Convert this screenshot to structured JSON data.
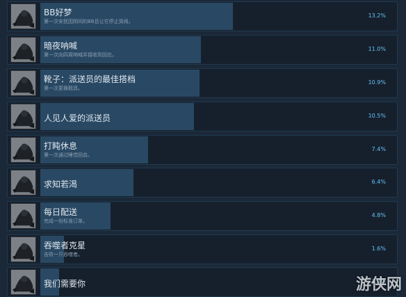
{
  "achievements": [
    {
      "title": "BB好梦",
      "desc": "第一次安抚因阴间的BB且让它停止哭闹。",
      "percent": "13.2%",
      "fill": 0.132,
      "icon": "bb-pod-icon"
    },
    {
      "title": "暗夜呐喊",
      "desc": "第一次向四周呐喊并接收到回应。",
      "percent": "11.0%",
      "fill": 0.11,
      "icon": "shout-icon"
    },
    {
      "title": "靴子：派送员的最佳搭档",
      "desc": "第一次更换鞋具。",
      "percent": "10.9%",
      "fill": 0.109,
      "icon": "boots-icon"
    },
    {
      "title": "人见人爱的派送员",
      "desc": "",
      "percent": "10.5%",
      "fill": 0.105,
      "icon": "porter-icon"
    },
    {
      "title": "打盹休息",
      "desc": "第一次通过睡觉回血。",
      "percent": "7.4%",
      "fill": 0.074,
      "icon": "rest-icon"
    },
    {
      "title": "求知若渴",
      "desc": "",
      "percent": "6.4%",
      "fill": 0.064,
      "icon": "canteen-icon"
    },
    {
      "title": "每日配送",
      "desc": "完成一份标准订单。",
      "percent": "4.8%",
      "fill": 0.048,
      "icon": "delivery-icon"
    },
    {
      "title": "吞噬者克星",
      "desc": "击败一只吞噬者。",
      "percent": "1.6%",
      "fill": 0.016,
      "icon": "beast-icon"
    },
    {
      "title": "我们需要你",
      "desc": "",
      "percent": "1.3%",
      "fill": 0.013,
      "icon": "portrait-icon"
    }
  ],
  "watermark": "游侠网"
}
